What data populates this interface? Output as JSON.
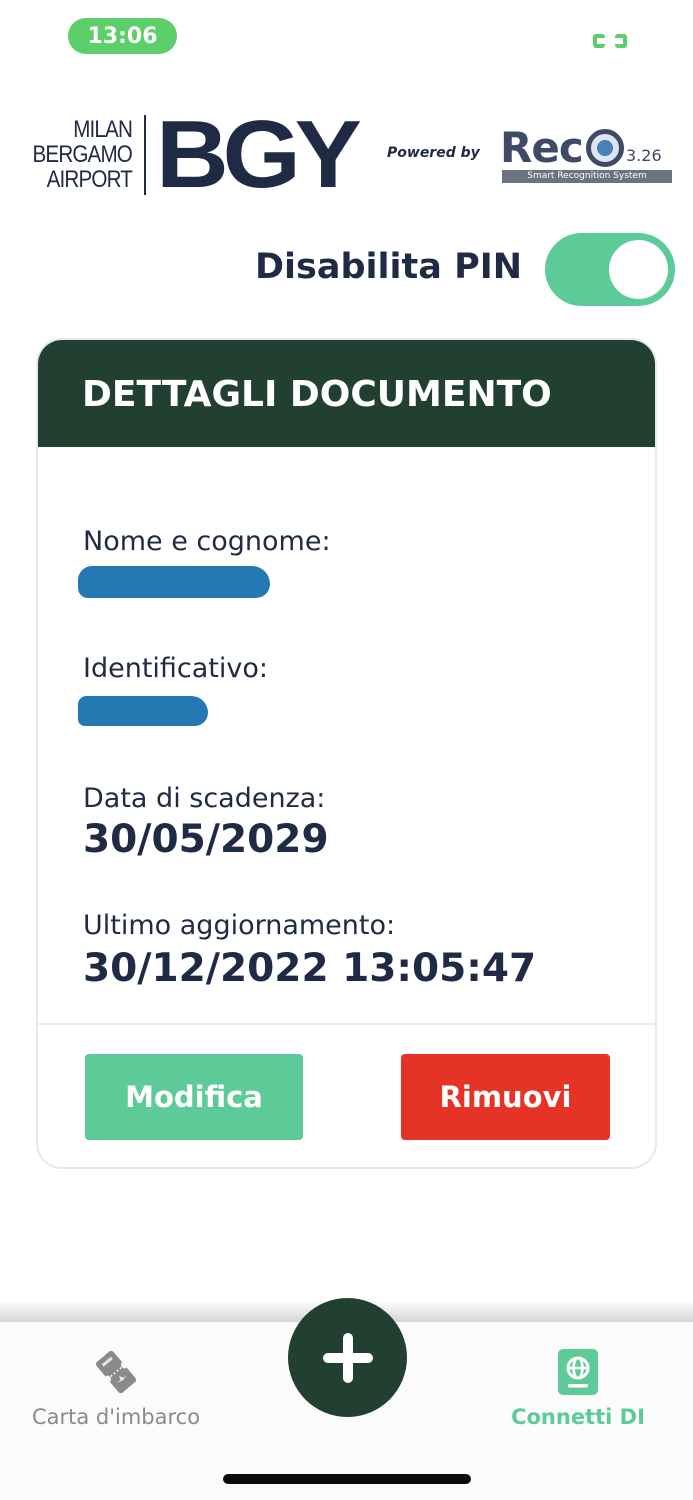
{
  "status_bar": {
    "time": "13:06"
  },
  "header": {
    "bgy_logo": {
      "city_line_1": "MILAN",
      "city_line_2": "BERGAMO",
      "city_line_3": "AIRPORT",
      "mark": "BGY"
    },
    "powered_by": "Powered by",
    "reco_logo": {
      "word": "Rec",
      "version": "3.26",
      "tagline": "Smart Recognition System"
    }
  },
  "pin_toggle": {
    "label": "Disabilita PIN",
    "enabled": true
  },
  "document_card": {
    "title": "DETTAGLI DOCUMENTO",
    "name_label": "Nome e cognome:",
    "id_label": "Identificativo:",
    "expiry_label": "Data di scadenza:",
    "expiry_value": "30/05/2029",
    "updated_label": "Ultimo aggiornamento:",
    "updated_value": "30/12/2022 13:05:47",
    "edit_button": "Modifica",
    "remove_button": "Rimuovi"
  },
  "bottom_nav": {
    "items": [
      {
        "label": "Carta d'imbarco",
        "icon": "boarding-pass-icon",
        "active": false
      },
      {
        "label": "Connetti DI",
        "icon": "passport-globe-icon",
        "active": true
      }
    ],
    "fab_icon": "plus-icon"
  },
  "colors": {
    "dark_green": "#224032",
    "accent_green": "#5ccb98",
    "status_green": "#5ccf6a",
    "danger_red": "#e53326",
    "navy_text": "#1f2a44",
    "redaction_blue": "#2579b2"
  }
}
